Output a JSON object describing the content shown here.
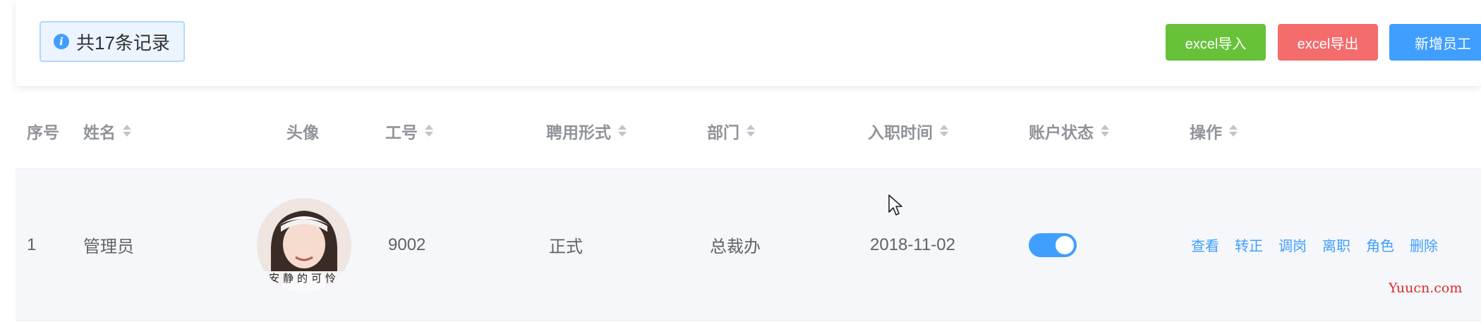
{
  "alert": {
    "text": "共17条记录",
    "icon": "info-icon"
  },
  "toolbar": {
    "import_label": "excel导入",
    "export_label": "excel导出",
    "add_label": "新增员工"
  },
  "table": {
    "columns": [
      "序号",
      "姓名",
      "头像",
      "工号",
      "聘用形式",
      "部门",
      "入职时间",
      "账户状态",
      "操作"
    ],
    "rows": [
      {
        "index": "1",
        "name": "管理员",
        "avatar_caption": "安静的可怜",
        "job_no": "9002",
        "employment": "正式",
        "department": "总裁办",
        "hire_date": "2018-11-02",
        "account_enabled": true,
        "actions": [
          "查看",
          "转正",
          "调岗",
          "离职",
          "角色",
          "删除"
        ]
      }
    ]
  },
  "watermark": "Yuucn.com",
  "colors": {
    "primary": "#409eff",
    "success": "#67c23a",
    "danger": "#f56c6c",
    "header_text": "#909399",
    "row_bg": "#f5f7fa"
  }
}
